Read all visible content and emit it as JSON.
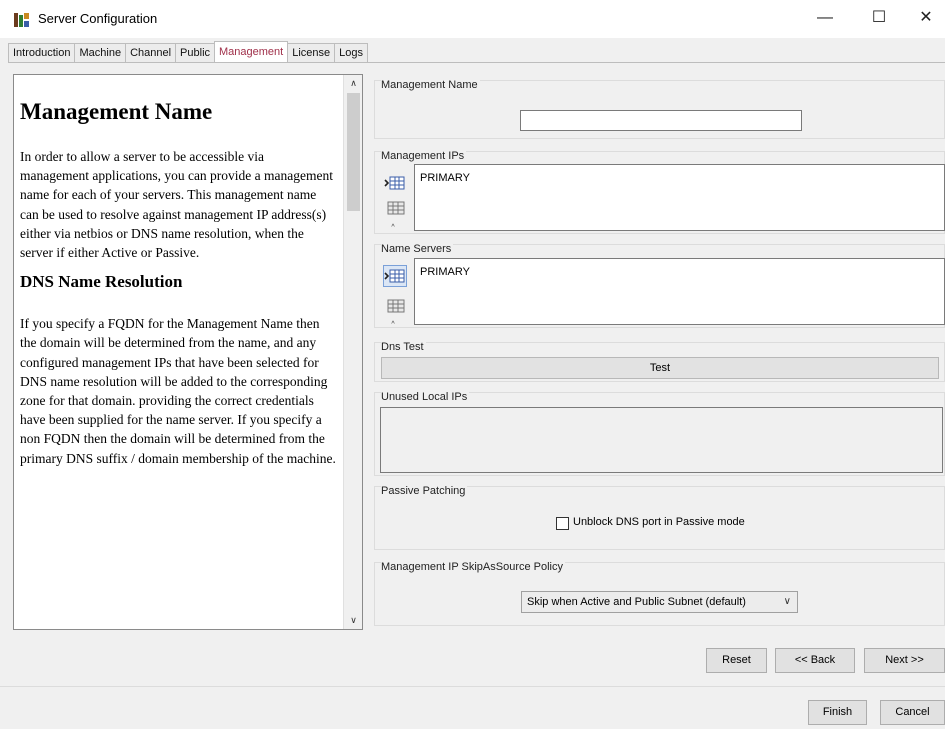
{
  "window": {
    "title": "Server Configuration",
    "minimize": "—",
    "maximize": "☐",
    "close": "✕"
  },
  "tabs": [
    {
      "label": "Introduction"
    },
    {
      "label": "Machine"
    },
    {
      "label": "Channel"
    },
    {
      "label": "Public"
    },
    {
      "label": "Management",
      "active": true
    },
    {
      "label": "License"
    },
    {
      "label": "Logs"
    }
  ],
  "help": {
    "heading": "Management Name",
    "para1": "In order to allow a server to be accessible via management applications, you can provide a management name for each of your servers. This management name can be used to resolve against management IP address(s) either via netbios or DNS name resolution, when the server if either Active or Passive.",
    "subheading": "DNS Name Resolution",
    "para2": "If you specify a FQDN for the Management Name then the domain will be determined from the name, and any configured management IPs that have been selected for DNS name resolution will be added to the corresponding zone for that domain. providing the correct credentials have been supplied for the name server. If you specify a non FQDN then the domain will be determined from the primary DNS suffix / domain membership of the machine.",
    "scroll_up": "∧",
    "scroll_down": "∨"
  },
  "management_name": {
    "title": "Management Name",
    "value": ""
  },
  "management_ips": {
    "title": "Management IPs",
    "items": [
      "PRIMARY"
    ]
  },
  "name_servers": {
    "title": "Name Servers",
    "items": [
      "PRIMARY"
    ]
  },
  "dns_test": {
    "title": "Dns Test",
    "button": "Test"
  },
  "unused_local_ips": {
    "title": "Unused Local IPs"
  },
  "passive_patching": {
    "title": "Passive Patching",
    "checkbox_label": "Unblock DNS port in Passive mode",
    "checked": false
  },
  "skip_policy": {
    "title": "Management IP SkipAsSource Policy",
    "selected": "Skip when Active and Public Subnet (default)",
    "arrow": "∨"
  },
  "buttons": {
    "reset": "Reset",
    "back": "<< Back",
    "next": "Next >>",
    "finish": "Finish",
    "cancel": "Cancel"
  },
  "colors": {
    "active_tab_text": "#a0304a",
    "window_bg": "#f0f0f0"
  }
}
